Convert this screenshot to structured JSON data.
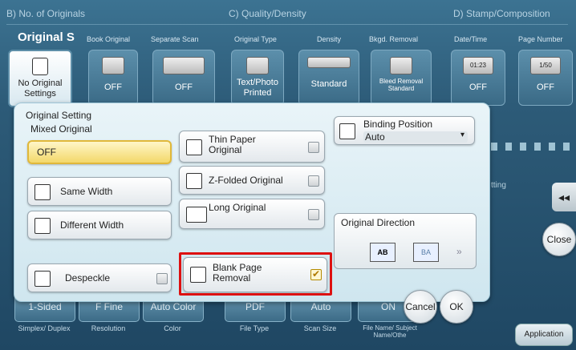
{
  "sections": {
    "b": "B) No. of Originals",
    "c": "C) Quality/Density",
    "d": "D) Stamp/Composition"
  },
  "top_row": {
    "original_settings_title": "Original S",
    "book_original": "Book Original",
    "separate_scan": "Separate Scan",
    "original_type": "Original Type",
    "density": "Density",
    "bkgd_removal": "Bkgd. Removal",
    "date_time": "Date/Time",
    "page_number": "Page Number"
  },
  "tiles": {
    "no_original_settings": "No Original Settings",
    "book_off": "OFF",
    "separate_off": "OFF",
    "text_photo_printed": "Text/Photo Printed",
    "standard": "Standard",
    "bleed_removal_standard": "Bleed Removal Standard",
    "date_off": "OFF",
    "page_off": "OFF",
    "date_badge": "01:23",
    "page_badge": "1/50"
  },
  "dialog": {
    "original_setting": "Original Setting",
    "mixed_original": "Mixed Original",
    "off": "OFF",
    "same_width": "Same Width",
    "different_width": "Different Width",
    "thin_paper": "Thin Paper Original",
    "z_folded": "Z-Folded Original",
    "long_original": "Long Original",
    "despeckle": "Despeckle",
    "blank_page_removal": "Blank Page Removal",
    "binding_position": "Binding Position",
    "binding_value": "Auto",
    "original_direction": "Original Direction",
    "dir_ab": "AB",
    "dir_ba": "BA",
    "cancel": "Cancel",
    "ok": "OK",
    "setting_partial": "tting",
    "close": "Close"
  },
  "bottom": {
    "b1": "1-Sided",
    "b2": "F Fine",
    "b3": "Auto Color",
    "b4": "PDF",
    "b5": "Auto",
    "b6": "ON",
    "l1": "Simplex/ Duplex",
    "l2": "Resolution",
    "l3": "Color",
    "l4": "File Type",
    "l5": "Scan Size",
    "l6": "File Name/ Subject Name/Othe",
    "application": "Application"
  }
}
